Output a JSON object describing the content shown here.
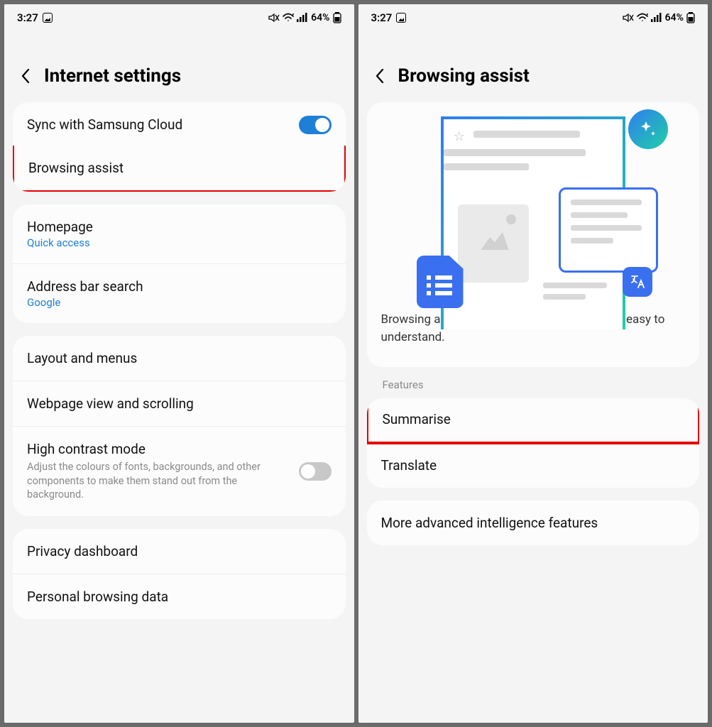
{
  "status": {
    "time": "3:27",
    "battery": "64%"
  },
  "left": {
    "title": "Internet settings",
    "sync": {
      "label": "Sync with Samsung Cloud"
    },
    "browsing_assist": {
      "label": "Browsing assist"
    },
    "homepage": {
      "label": "Homepage",
      "value": "Quick access"
    },
    "address_bar": {
      "label": "Address bar search",
      "value": "Google"
    },
    "layout": {
      "label": "Layout and menus"
    },
    "webpage_view": {
      "label": "Webpage view and scrolling"
    },
    "high_contrast": {
      "label": "High contrast mode",
      "desc": "Adjust the colours of fonts, backgrounds, and other components to make them stand out from the background."
    },
    "privacy": {
      "label": "Privacy dashboard"
    },
    "personal": {
      "label": "Personal browsing data"
    }
  },
  "right": {
    "title": "Browsing assist",
    "description": "Browsing assist makes content on webpages easy to understand.",
    "features_label": "Features",
    "summarise": {
      "label": "Summarise"
    },
    "translate": {
      "label": "Translate"
    },
    "more": {
      "label": "More advanced intelligence features"
    }
  }
}
